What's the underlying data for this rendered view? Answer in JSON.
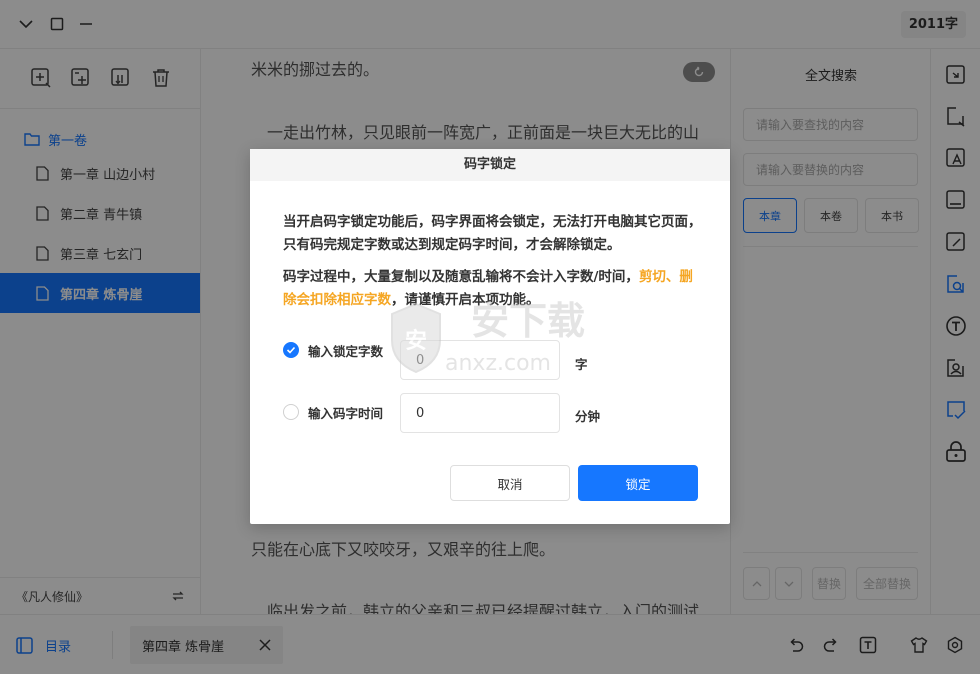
{
  "window": {
    "word_count": "2011字"
  },
  "sidebar": {
    "tools": [
      "add-chapter-icon",
      "add-volume-icon",
      "import-icon",
      "trash-icon"
    ],
    "volume": {
      "label": "第一卷"
    },
    "chapters": [
      {
        "label": "第一章 山边小村",
        "active": false
      },
      {
        "label": "第二章 青牛镇",
        "active": false
      },
      {
        "label": "第三章 七玄门",
        "active": false
      },
      {
        "label": "第四章 炼骨崖",
        "active": true
      }
    ],
    "book_title": "《凡人修仙》"
  },
  "editor": {
    "paragraphs": [
      "米米的挪过去的。",
      "一走出竹林，只见眼前一阵宽广，正前面是一块巨大无比的山",
      "只能在心底下又咬咬牙，又艰辛的往上爬。",
      "临出发之前，韩立的父亲和三叔已经提醒过韩立，入门的测试"
    ]
  },
  "search": {
    "title": "全文搜索",
    "find_placeholder": "请输入要查找的内容",
    "replace_placeholder": "请输入要替换的内容",
    "scopes": [
      {
        "label": "本章",
        "active": true
      },
      {
        "label": "本卷",
        "active": false
      },
      {
        "label": "本书",
        "active": false
      }
    ],
    "replace_label": "替换",
    "replace_all_label": "全部替换"
  },
  "right_toolbar": {
    "tools": [
      "export-icon",
      "frame-icon",
      "font-icon",
      "panel-icon",
      "edit-icon",
      "search-icon",
      "text-icon",
      "character-icon",
      "check-icon",
      "lock-icon"
    ],
    "active": "search-icon"
  },
  "bottom": {
    "toc_label": "目录",
    "tab_label": "第四章 炼骨崖",
    "tools": [
      "undo-icon",
      "redo-icon",
      "text-format-icon",
      "theme-icon",
      "settings-icon"
    ]
  },
  "dialog": {
    "title": "码字锁定",
    "desc1": "当开启码字锁定功能后，码字界面将会锁定，无法打开电脑其它页面，只有码完规定字数或达到规定码字时间，才会解除锁定。",
    "desc2_prefix": "码字过程中，大量复制以及随意乱输将不会计入字数/时间，",
    "desc2_warning": "剪切、删除会扣除相应字数",
    "desc2_suffix": "，请谨慎开启本项功能。",
    "options": [
      {
        "label": "输入锁定字数",
        "value": "0",
        "unit": "字",
        "checked": true
      },
      {
        "label": "输入码字时间",
        "value": "0",
        "unit": "分钟",
        "checked": false
      }
    ],
    "cancel_label": "取消",
    "confirm_label": "锁定"
  },
  "watermark": {
    "text_cn": "安下载",
    "text_en": "anxz.com"
  },
  "colors": {
    "accent": "#1677ff",
    "warning": "#f5a623",
    "overlay": "rgba(0,0,0,0.45)"
  }
}
